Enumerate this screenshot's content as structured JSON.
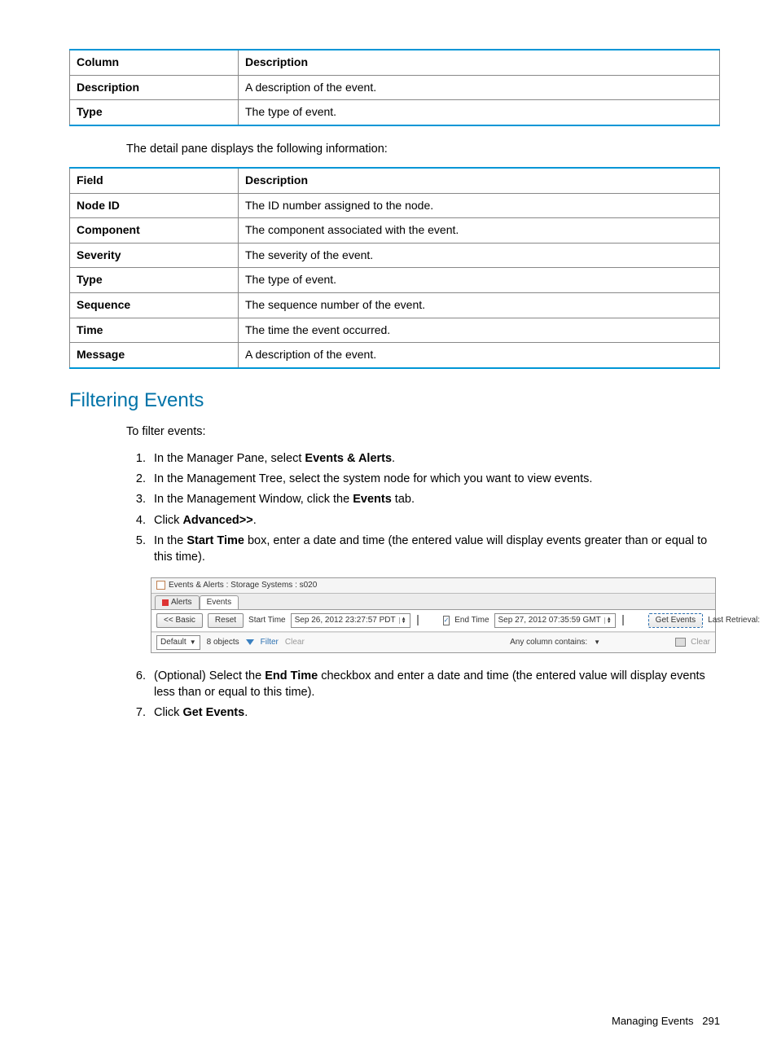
{
  "table1": {
    "headers": [
      "Column",
      "Description"
    ],
    "rows": [
      [
        "Description",
        "A description of the event."
      ],
      [
        "Type",
        "The type of event."
      ]
    ]
  },
  "intro1": "The detail pane displays the following information:",
  "table2": {
    "headers": [
      "Field",
      "Description"
    ],
    "rows": [
      [
        "Node ID",
        "The ID number assigned to the node."
      ],
      [
        "Component",
        "The component associated with the event."
      ],
      [
        "Severity",
        "The severity of the event."
      ],
      [
        "Type",
        "The type of event."
      ],
      [
        "Sequence",
        "The sequence number of the event."
      ],
      [
        "Time",
        "The time the event occurred."
      ],
      [
        "Message",
        "A description of the event."
      ]
    ]
  },
  "section_heading": "Filtering Events",
  "intro2": "To filter events:",
  "steps_part1": [
    {
      "pre": "In the Manager Pane, select ",
      "bold": "Events & Alerts",
      "post": "."
    },
    {
      "pre": "In the Management Tree, select the system node for which you want to view events.",
      "bold": "",
      "post": ""
    },
    {
      "pre": "In the Management Window, click the ",
      "bold": "Events",
      "post": " tab."
    },
    {
      "pre": "Click ",
      "bold": "Advanced>>",
      "post": "."
    },
    {
      "pre": "In the ",
      "bold": "Start Time",
      "post": " box, enter a date and time (the entered value will display events greater than or equal to this time)."
    }
  ],
  "ui": {
    "title": "Events & Alerts : Storage Systems : s020",
    "tabs": {
      "alerts": "Alerts",
      "events": "Events"
    },
    "toolbar": {
      "basic": "<< Basic",
      "reset": "Reset",
      "start_label": "Start Time",
      "start_value": "Sep 26, 2012 23:27:57 PDT",
      "end_check": "✓",
      "end_label": "End Time",
      "end_value": "Sep 27, 2012 07:35:59 GMT",
      "get_events": "Get Events",
      "last_retrieval": "Last Retrieval:"
    },
    "filterbar": {
      "default": "Default",
      "objects": "8 objects",
      "filter": "Filter",
      "clear_left": "Clear",
      "column_contains": "Any column contains:",
      "clear_right": "Clear"
    }
  },
  "steps_part2": [
    {
      "pre": "(Optional) Select the ",
      "bold": "End Time",
      "post": " checkbox and enter a date and time (the entered value will display events less than or equal to this time)."
    },
    {
      "pre": "Click ",
      "bold": "Get Events",
      "post": "."
    }
  ],
  "footer": {
    "text": "Managing Events",
    "page": "291"
  }
}
